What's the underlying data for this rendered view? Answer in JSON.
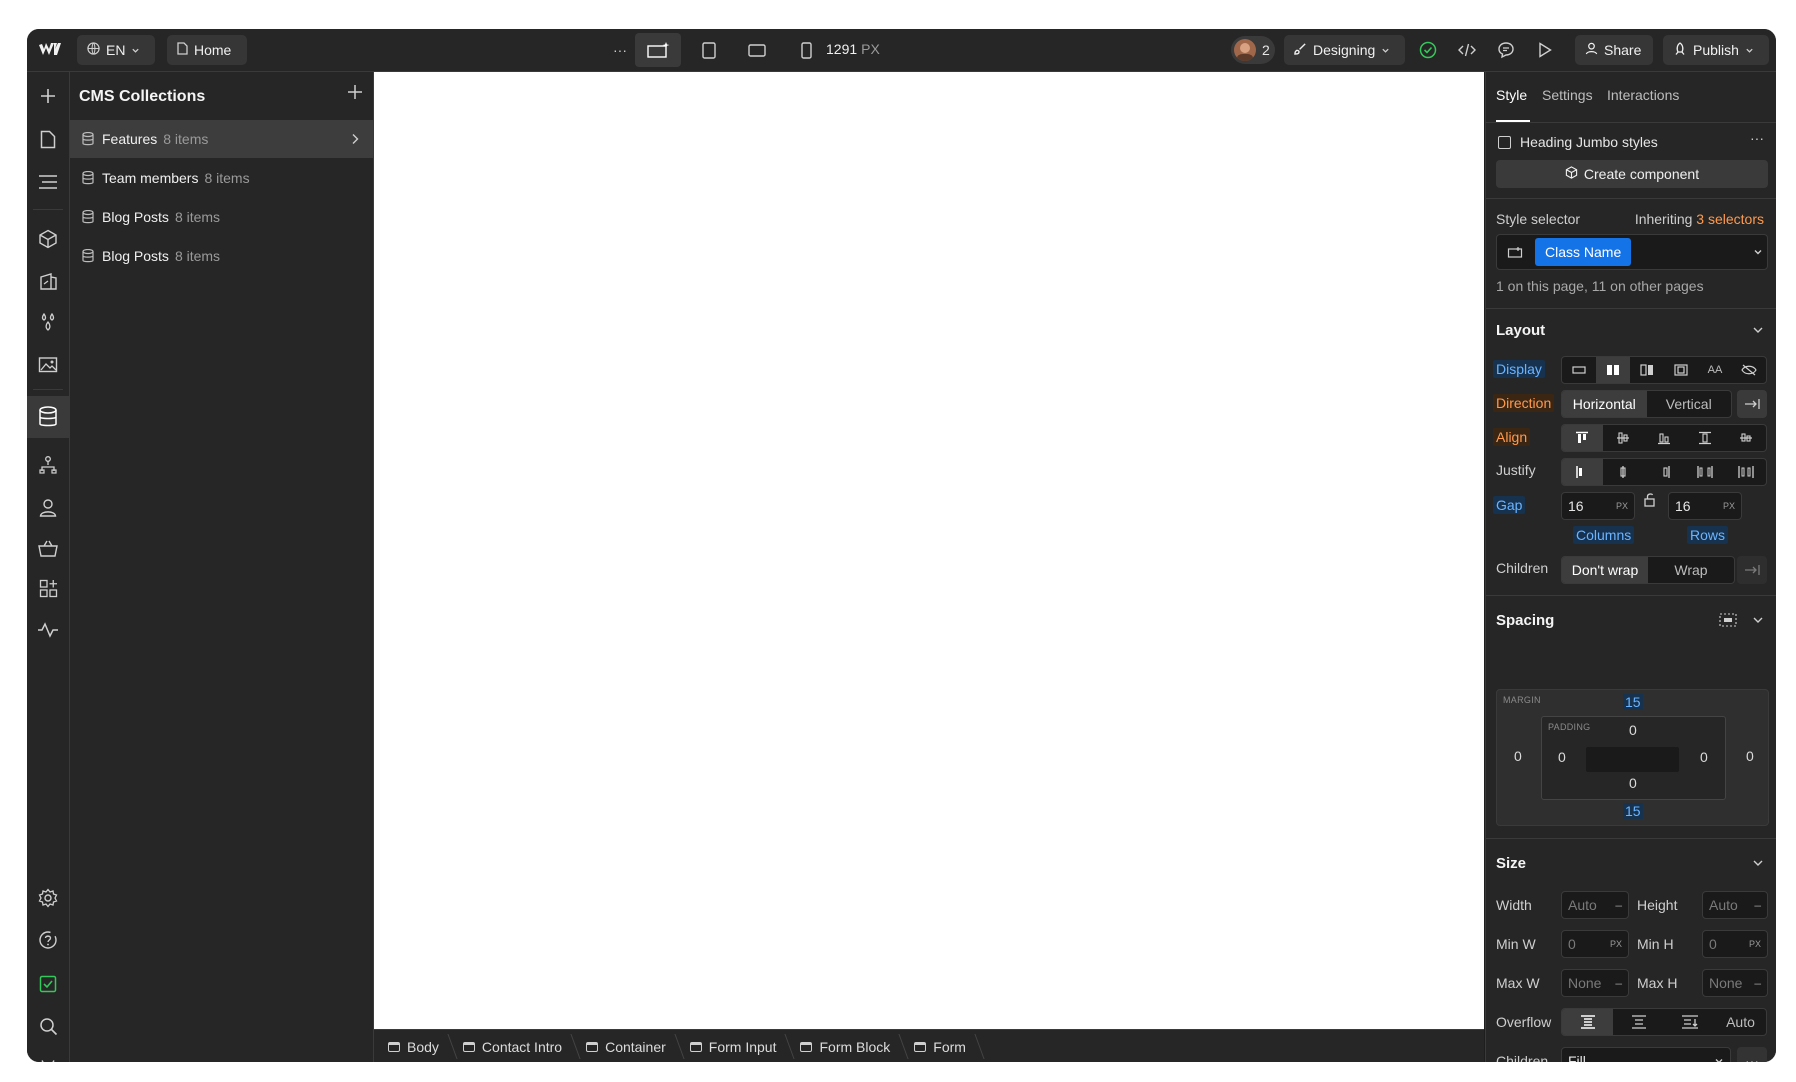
{
  "topbar": {
    "language": "EN",
    "page": "Home",
    "more": "···",
    "width_value": "1291",
    "width_unit": "PX",
    "collaborators_count": "2",
    "mode": "Designing",
    "share": "Share",
    "publish": "Publish"
  },
  "cms": {
    "title": "CMS Collections",
    "collections": [
      {
        "name": "Features",
        "count": "8 items"
      },
      {
        "name": "Team members",
        "count": "8 items"
      },
      {
        "name": "Blog Posts",
        "count": "8 items"
      },
      {
        "name": "Blog Posts",
        "count": "8 items"
      }
    ]
  },
  "breadcrumb": [
    "Body",
    "Contact Intro",
    "Container",
    "Form Input",
    "Form Block",
    "Form"
  ],
  "panel": {
    "tabs": [
      "Style",
      "Settings",
      "Interactions"
    ],
    "heading_styles": "Heading Jumbo styles",
    "create_component": "Create component",
    "style_selector_label": "Style selector",
    "inheriting_prefix": "Inheriting",
    "inheriting_count": "3 selectors",
    "class_name": "Class Name",
    "usage": "1 on this page, 11 on other pages",
    "layout": {
      "title": "Layout",
      "display": "Display",
      "direction": "Direction",
      "direction_options": [
        "Horizontal",
        "Vertical"
      ],
      "align": "Align",
      "justify": "Justify",
      "gap": "Gap",
      "gap_columns": "16",
      "gap_rows": "16",
      "gap_unit": "PX",
      "columns_label": "Columns",
      "rows_label": "Rows",
      "children": "Children",
      "wrap_options": [
        "Don't wrap",
        "Wrap"
      ]
    },
    "spacing": {
      "title": "Spacing",
      "margin_label": "MARGIN",
      "padding_label": "PADDING",
      "margin_top": "15",
      "margin_bottom": "15",
      "margin_left": "0",
      "margin_right": "0",
      "padding_top": "0",
      "padding_bottom": "0",
      "padding_left": "0",
      "padding_right": "0"
    },
    "size": {
      "title": "Size",
      "width": "Width",
      "width_val": "Auto",
      "height": "Height",
      "height_val": "Auto",
      "min_w": "Min W",
      "min_w_val": "0",
      "min_h": "Min H",
      "min_h_val": "0",
      "max_w": "Max W",
      "max_w_val": "None",
      "max_h": "Max H",
      "max_h_val": "None",
      "unit": "PX",
      "dash": "–",
      "overflow": "Overflow",
      "overflow_auto": "Auto",
      "children": "Children",
      "children_val": "Fill",
      "more": "···"
    }
  },
  "colors": {
    "accent_blue": "#1473e6",
    "label_blue": "#5aa7ff",
    "label_orange": "#ff9a4d",
    "status_green": "#34c759"
  }
}
